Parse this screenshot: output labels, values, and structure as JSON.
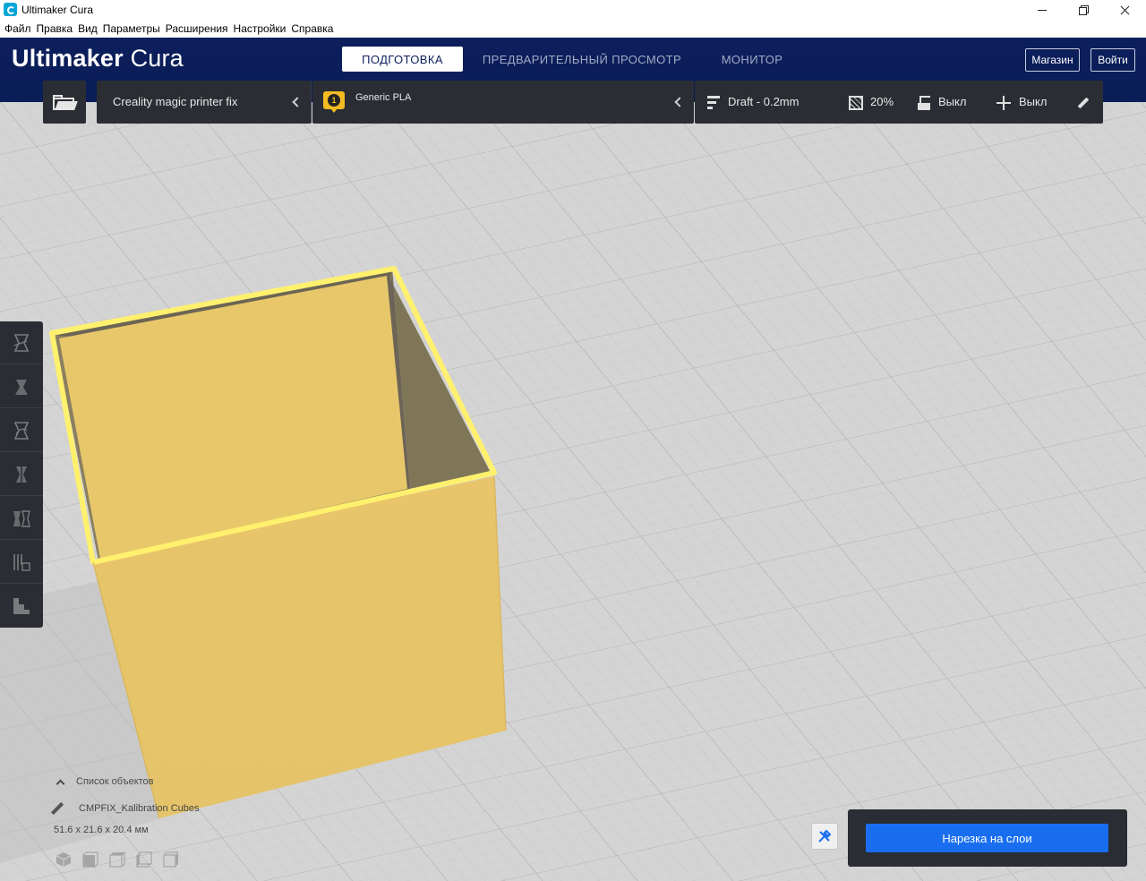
{
  "window": {
    "title": "Ultimaker Cura",
    "controls": [
      "minimize",
      "maximize",
      "close"
    ]
  },
  "menu": [
    "Файл",
    "Правка",
    "Вид",
    "Параметры",
    "Расширения",
    "Настройки",
    "Справка"
  ],
  "header": {
    "logo_bold": "Ultimaker",
    "logo_thin": "Cura",
    "stages": [
      "ПОДГОТОВКА",
      "ПРЕДВАРИТЕЛЬНЫЙ ПРОСМОТР",
      "МОНИТОР"
    ],
    "active_stage": "ПОДГОТОВКА",
    "marketplace": "Магазин",
    "login": "Войти"
  },
  "toolbar": {
    "open_icon": "folder-open-icon",
    "printer": "Creality magic printer fix",
    "extruder_number": "1",
    "material": "Generic PLA",
    "profile": "Draft - 0.2mm",
    "infill": "20%",
    "support": "Выкл",
    "adhesion": "Выкл",
    "colors": {
      "panel": "#2a2d33",
      "extruder": "#f3bb22",
      "header": "#0c1f5c"
    }
  },
  "tools": [
    "move-tool-icon",
    "scale-tool-icon",
    "rotate-tool-icon",
    "mirror-tool-icon",
    "per-model-settings-icon",
    "support-blocker-icon",
    "layer-view-icon"
  ],
  "objects": {
    "toggle": "Список объектов",
    "name": "CMPFIX_Kalibration Cubes",
    "dimensions": "51.6 x 21.6 x 20.4 мм",
    "view_buttons": [
      "view-3d-icon",
      "view-front-icon",
      "view-top-icon",
      "view-left-icon",
      "view-right-icon"
    ]
  },
  "slice": {
    "label": "Нарезка на слои",
    "color": "#196ef0"
  },
  "model": {
    "color": "#ecc868",
    "outline": "#fff176"
  }
}
